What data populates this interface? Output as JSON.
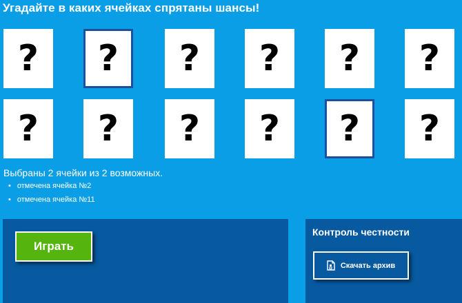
{
  "title": "Угадайте в каких ячейках спрятаны шансы!",
  "cells": [
    {
      "symbol": "?",
      "selected": false
    },
    {
      "symbol": "?",
      "selected": true
    },
    {
      "symbol": "?",
      "selected": false
    },
    {
      "symbol": "?",
      "selected": false
    },
    {
      "symbol": "?",
      "selected": false
    },
    {
      "symbol": "?",
      "selected": false
    },
    {
      "symbol": "?",
      "selected": false
    },
    {
      "symbol": "?",
      "selected": false
    },
    {
      "symbol": "?",
      "selected": false
    },
    {
      "symbol": "?",
      "selected": false
    },
    {
      "symbol": "?",
      "selected": true
    },
    {
      "symbol": "?",
      "selected": false
    }
  ],
  "status": {
    "text": "Выбраны 2 ячейки из 2 возможных.",
    "marks": [
      "отмечена ячейка №2",
      "отмечена ячейка №11"
    ]
  },
  "actions": {
    "play_label": "Играть"
  },
  "honesty": {
    "title": "Контроль честности",
    "download_label": "Скачать архив",
    "download_icon": "archive-file-icon"
  },
  "colors": {
    "background": "#0a9ee6",
    "panel": "#075aa0",
    "play_button": "#56b40f",
    "selected_border": "#1c4f9c"
  }
}
